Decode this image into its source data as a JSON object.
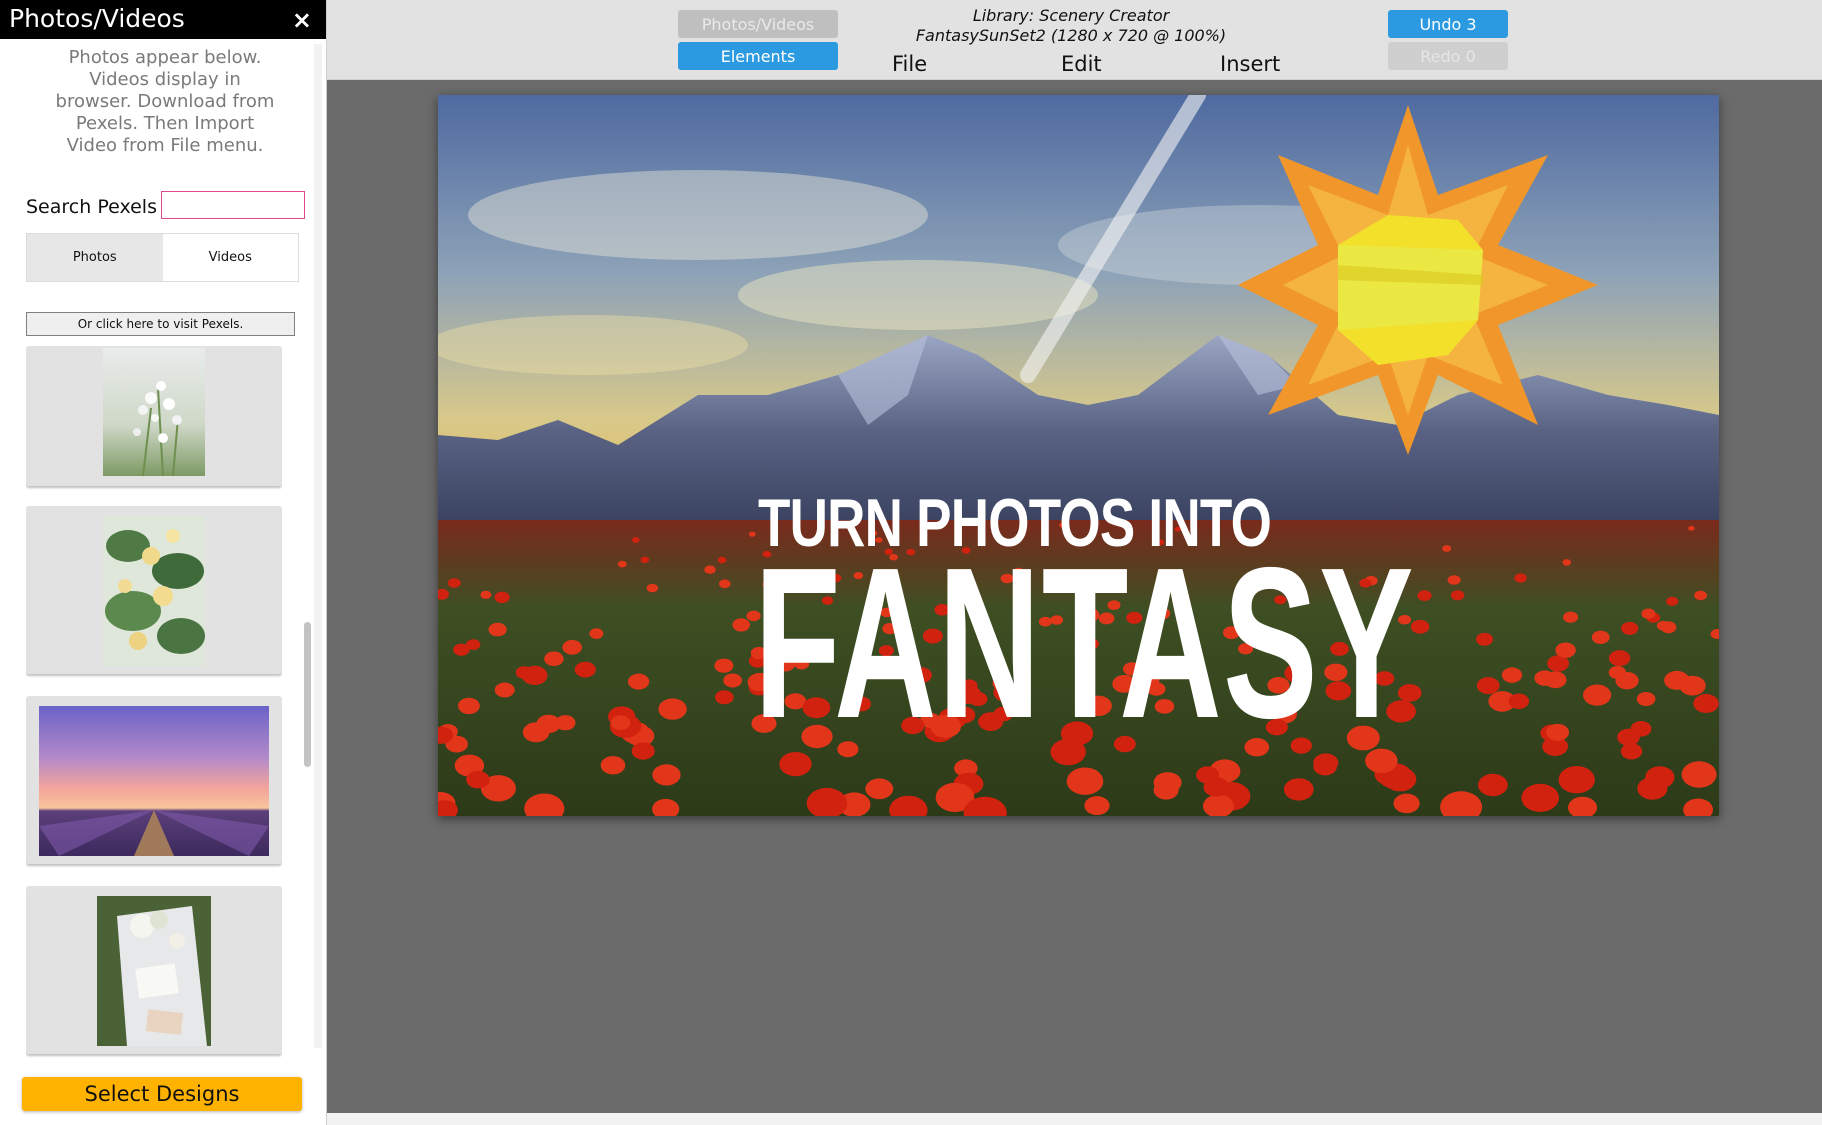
{
  "panel": {
    "title": "Photos/Videos",
    "close_glyph": "×",
    "info": "Photos appear below. Videos display in browser. Download from Pexels. Then Import Video from File menu.",
    "search_label": "Search Pexels",
    "search_value": "",
    "tabs": [
      {
        "label": "Photos",
        "active": true
      },
      {
        "label": "Videos",
        "active": false
      }
    ],
    "visit_link": "Or click here to visit Pexels.",
    "thumbnails": [
      {
        "subject": "white flowers"
      },
      {
        "subject": "yellow roses"
      },
      {
        "subject": "lavender field at sunset"
      },
      {
        "subject": "flowers on cloth"
      }
    ],
    "select_designs": "Select Designs"
  },
  "toolbar": {
    "photos_videos": "Photos/Videos",
    "elements": "Elements",
    "library": "Library: Scenery Creator",
    "file_info": "FantasySunSet2 (1280 x 720 @ 100%)",
    "menus": [
      "File",
      "Edit",
      "Insert"
    ],
    "undo": "Undo 3",
    "redo": "Redo 0"
  },
  "canvas": {
    "headline_small": "TURN PHOTOS INTO",
    "headline_big": "FANTASY"
  },
  "colors": {
    "accent_blue": "#2c9ae0",
    "select_button": "#ffb300",
    "workspace": "#6b6b6b",
    "search_border": "#e04a8a"
  }
}
